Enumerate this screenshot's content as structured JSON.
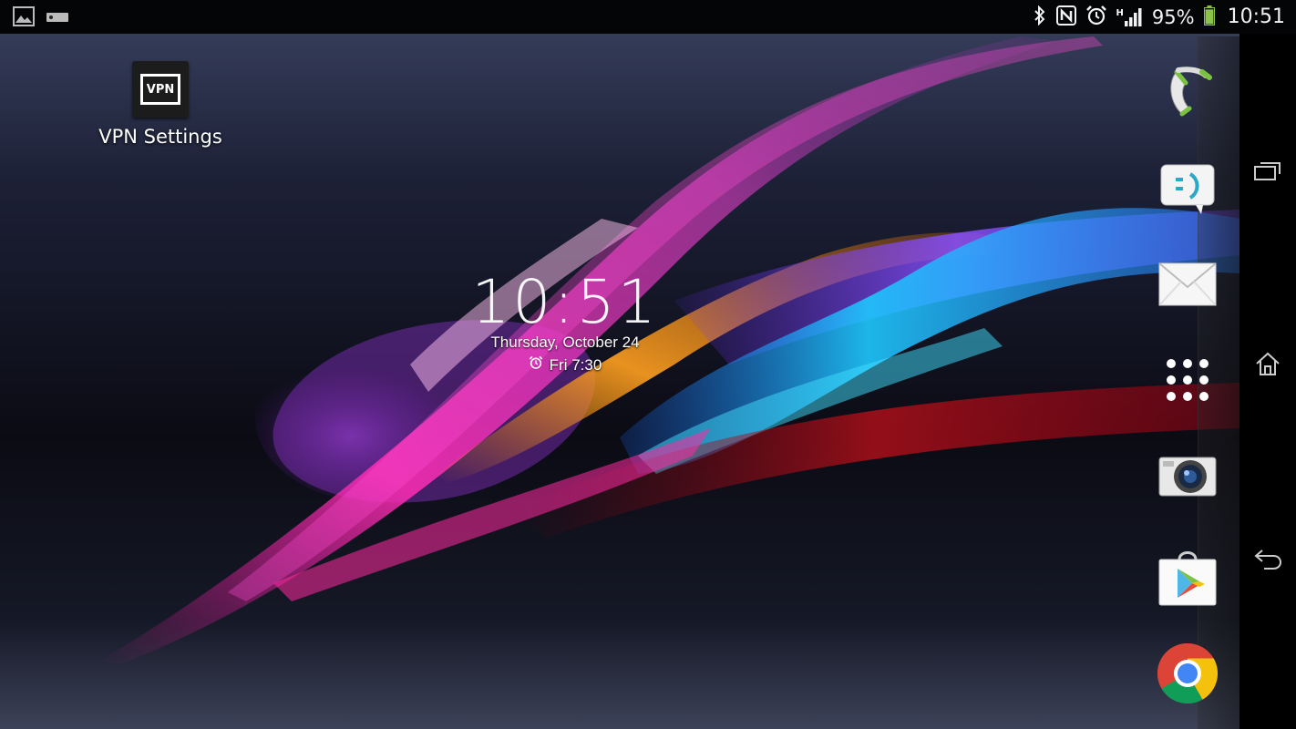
{
  "status_bar": {
    "left_icons": [
      "image-notification-icon",
      "storage-notification-icon"
    ],
    "right_icons": [
      "bluetooth-icon",
      "nfc-icon",
      "alarm-icon",
      "signal-h-icon",
      "battery-icon"
    ],
    "network_type": "H",
    "battery_percent": "95%",
    "battery_level": 0.95,
    "time": "10:51"
  },
  "desktop": {
    "shortcut": {
      "icon_text": "VPN",
      "label": "VPN Settings"
    }
  },
  "clock_widget": {
    "time": "10:51",
    "date": "Thursday, October 24",
    "alarm": "Fri 7:30"
  },
  "dock": {
    "items": [
      "phone-icon",
      "messaging-icon",
      "email-icon",
      "app-drawer-icon",
      "camera-icon",
      "play-store-icon",
      "chrome-icon"
    ]
  },
  "nav_bar": {
    "buttons": [
      "recent-apps-icon",
      "home-icon",
      "back-icon"
    ]
  },
  "colors": {
    "status_bar_bg": "#000000",
    "battery_green": "#8bc34a",
    "phone_green": "#7cc242",
    "chrome_red": "#db4437",
    "chrome_yellow": "#f4c20d",
    "chrome_green": "#0f9d58",
    "chrome_blue": "#4285f4"
  }
}
